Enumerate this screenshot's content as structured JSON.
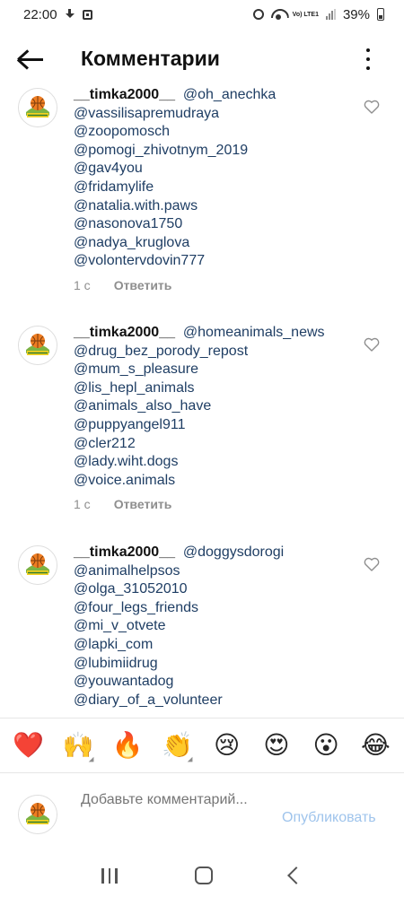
{
  "status_bar": {
    "time": "22:00",
    "network": "Vo) LTE1",
    "battery": "39%"
  },
  "header": {
    "title": "Комментарии"
  },
  "comments": [
    {
      "username": "__timka2000__",
      "first_mention": "@oh_anechka",
      "mentions": [
        "@vassilisapremudraya",
        "@zoopomosch",
        "@pomogi_zhivotnym_2019",
        "@gav4you",
        "@fridamylife",
        "@natalia.with.paws",
        "@nasonova1750",
        "@nadya_kruglova",
        "@volontervdovin777"
      ],
      "time": "1 с",
      "reply_label": "Ответить"
    },
    {
      "username": "__timka2000__",
      "first_mention": "@homeanimals_news",
      "mentions": [
        "@drug_bez_porody_repost",
        "@mum_s_pleasure",
        "@lis_hepl_animals",
        "@animals_also_have",
        "@puppyangel911",
        "@cler212",
        "@lady.wiht.dogs",
        "@voice.animals"
      ],
      "time": "1 с",
      "reply_label": "Ответить"
    },
    {
      "username": "__timka2000__",
      "first_mention": "@doggysdorogi",
      "mentions": [
        "@animalhelpsos",
        "@olga_31052010",
        "@four_legs_friends",
        "@mi_v_otvete",
        "@lapki_com",
        "@lubimiidrug",
        "@youwantadog",
        "@diary_of_a_volunteer"
      ]
    }
  ],
  "emoji_bar": [
    {
      "glyph": "❤️",
      "name": "red-heart"
    },
    {
      "glyph": "🙌",
      "name": "raising-hands"
    },
    {
      "glyph": "🔥",
      "name": "fire"
    },
    {
      "glyph": "👏",
      "name": "clapping-hands"
    },
    {
      "glyph": "😢",
      "name": "crying-face"
    },
    {
      "glyph": "😍",
      "name": "heart-eyes"
    },
    {
      "glyph": "😮",
      "name": "surprised-face"
    },
    {
      "glyph": "😂",
      "name": "tears-of-joy"
    }
  ],
  "composer": {
    "placeholder": "Добавьте комментарий...",
    "publish_label": "Опубликовать"
  },
  "colors": {
    "mention": "#1f3e64",
    "muted": "#8e8e8e",
    "publish_disabled": "#9fc4ec"
  }
}
